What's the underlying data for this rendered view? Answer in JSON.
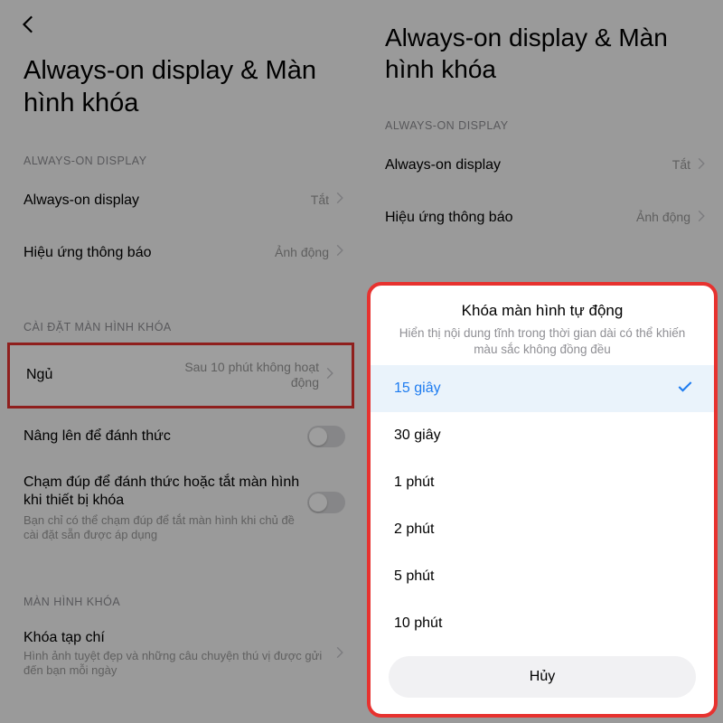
{
  "left": {
    "title": "Always-on display & Màn hình khóa",
    "section_aod": "ALWAYS-ON DISPLAY",
    "aod_row": {
      "label": "Always-on display",
      "value": "Tắt"
    },
    "effect_row": {
      "label": "Hiệu ứng thông báo",
      "value": "Ảnh động"
    },
    "section_lock": "CÀI ĐẶT MÀN HÌNH KHÓA",
    "sleep_row": {
      "label": "Ngủ",
      "value": "Sau 10 phút không hoạt động"
    },
    "raise_row": {
      "label": "Nâng lên để đánh thức"
    },
    "dtap_row": {
      "label": "Chạm đúp để đánh thức hoặc tắt màn hình khi thiết bị khóa",
      "sub": "Bạn chỉ có thể chạm đúp để tắt màn hình khi chủ đề cài đặt sẵn được áp dụng"
    },
    "section_ls": "MÀN HÌNH KHÓA",
    "mag_row": {
      "label": "Khóa tạp chí",
      "sub": "Hình ảnh tuyệt đẹp và những câu chuyện thú vị được gửi đến bạn mỗi ngày"
    }
  },
  "right": {
    "title": "Always-on display & Màn hình khóa",
    "section_aod": "ALWAYS-ON DISPLAY",
    "aod_row": {
      "label": "Always-on display",
      "value": "Tắt"
    },
    "effect_row": {
      "label": "Hiệu ứng thông báo",
      "value": "Ảnh động"
    }
  },
  "sheet": {
    "title": "Khóa màn hình tự động",
    "subtitle": "Hiển thị nội dung tĩnh trong thời gian dài có thể khiến màu sắc không đồng đều",
    "options": {
      "o0": "15 giây",
      "o1": "30 giây",
      "o2": "1 phút",
      "o3": "2 phút",
      "o4": "5 phút",
      "o5": "10 phút"
    },
    "cancel": "Hủy"
  }
}
